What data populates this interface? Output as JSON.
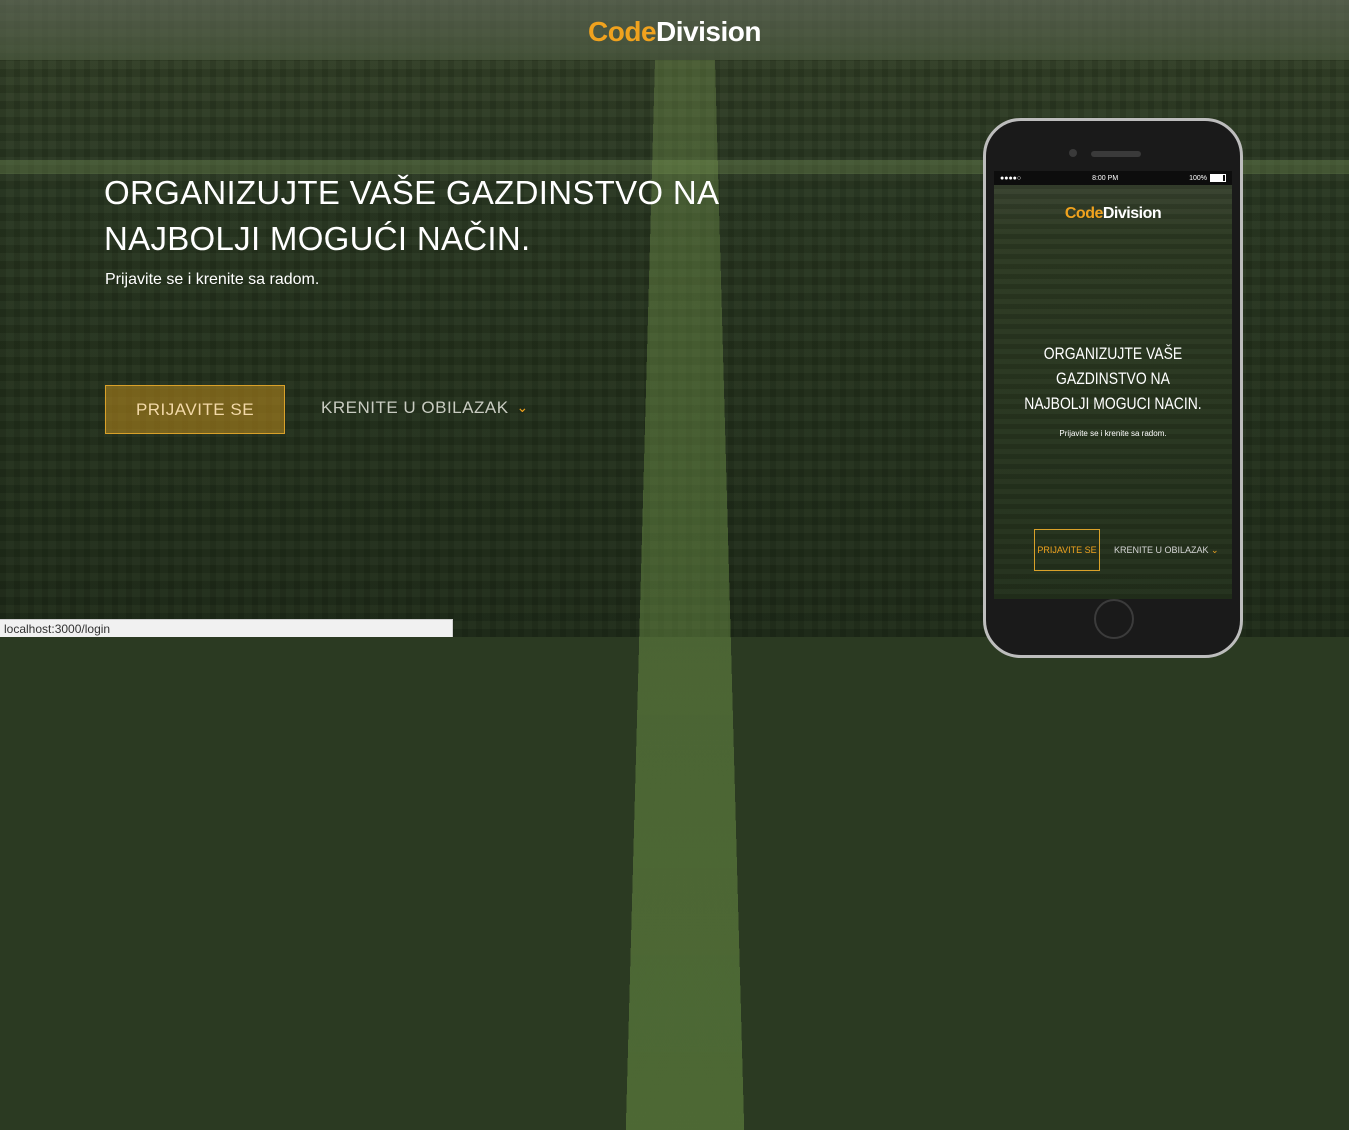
{
  "brand": {
    "part1": "Code",
    "part2": "Division"
  },
  "hero": {
    "headline_line1": "ORGANIZUJTE VAŠE GAZDINSTVO NA",
    "headline_line2": "NAJBOLJI MOGUĆI NAČIN.",
    "subline": "Prijavite se i krenite sa radom.",
    "login_button": "PRIJAVITE SE",
    "tour_link": "KRENITE U OBILAZAK",
    "tour_chevron": "⌄"
  },
  "phone": {
    "status": {
      "signal": "●●●●○",
      "time": "8:00 PM",
      "battery": "100%"
    },
    "brand": {
      "part1": "Code",
      "part2": "Division"
    },
    "headline_line1": "ORGANIZUJTE VAŠE GAZDINSTVO NA",
    "headline_line2": "NAJBOLJI MOGUCI NACIN.",
    "subline": "Prijavite se i krenite sa radom.",
    "login_button": "PRIJAVITE SE",
    "tour_link": "KRENITE U OBILAZAK",
    "tour_chevron": "⌄"
  },
  "status_bar": {
    "url": "localhost:3000/login"
  },
  "colors": {
    "accent": "#f0a21e",
    "text": "#ffffff",
    "tour_text": "#c9ccc2"
  }
}
